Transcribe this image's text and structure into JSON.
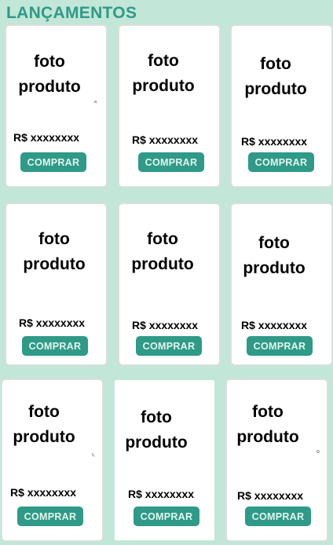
{
  "section": {
    "title": "LANÇAMENTOS"
  },
  "products": [
    {
      "photo_label": "foto\nproduto",
      "price": "R$ xxxxxxxx",
      "buy_label": "COMPRAR"
    },
    {
      "photo_label": "foto\nproduto",
      "price": "R$ xxxxxxxx",
      "buy_label": "COMPRAR"
    },
    {
      "photo_label": "foto\nproduto",
      "price": "R$ xxxxxxxx",
      "buy_label": "COMPRAR"
    },
    {
      "photo_label": "foto\nproduto",
      "price": "R$ xxxxxxxx",
      "buy_label": "COMPRAR"
    },
    {
      "photo_label": "foto\nproduto",
      "price": "R$ xxxxxxxx",
      "buy_label": "COMPRAR"
    },
    {
      "photo_label": "foto\nproduto",
      "price": "R$ xxxxxxxx",
      "buy_label": "COMPRAR"
    },
    {
      "photo_label": "foto\nproduto",
      "price": "R$ xxxxxxxx",
      "buy_label": "COMPRAR"
    },
    {
      "photo_label": "foto\nproduto",
      "price": "R$ xxxxxxxx",
      "buy_label": "COMPRAR"
    },
    {
      "photo_label": "foto\nproduto",
      "price": "R$ xxxxxxxx",
      "buy_label": "COMPRAR"
    }
  ],
  "colors": {
    "background": "#c2e6d8",
    "accent": "#2e9a87",
    "card": "#ffffff"
  }
}
